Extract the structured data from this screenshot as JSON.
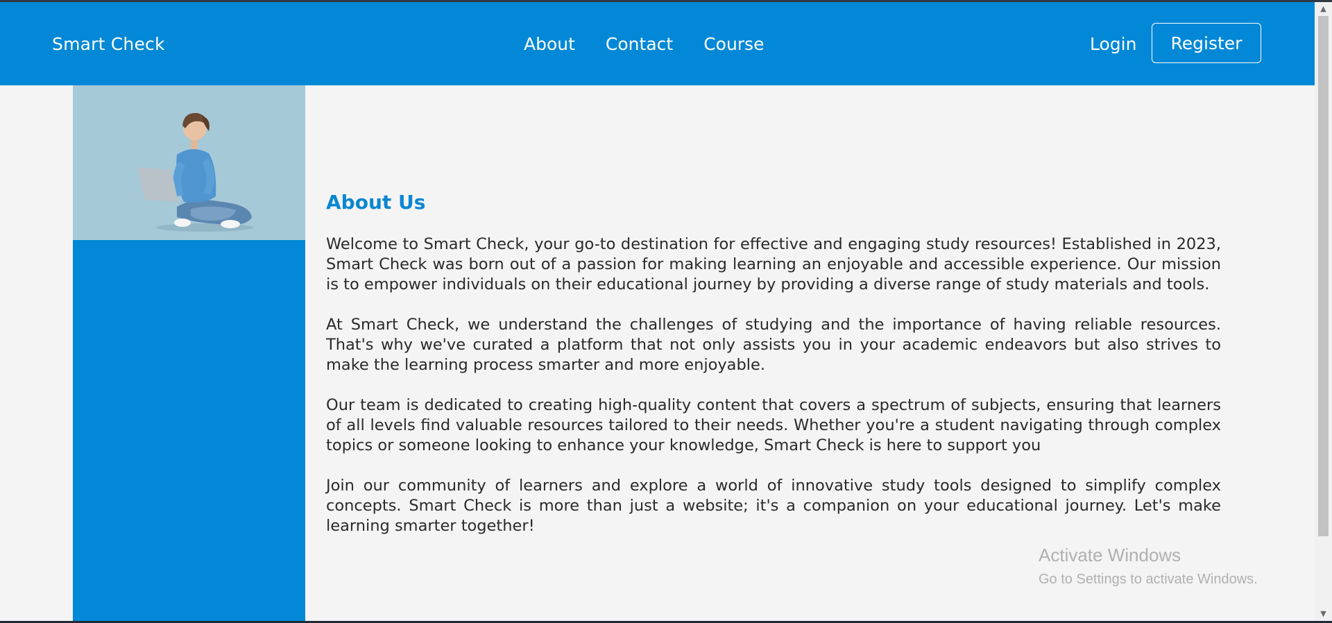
{
  "nav": {
    "brand": "Smart Check",
    "links": [
      "About",
      "Contact",
      "Course"
    ],
    "login": "Login",
    "register": "Register"
  },
  "about": {
    "heading": "About Us",
    "paragraphs": [
      "Welcome to Smart Check, your go-to destination for effective and engaging study resources! Established in 2023, Smart Check was born out of a passion for making learning an enjoyable and accessible experience. Our mission is to empower individuals on their educational journey by providing a diverse range of study materials and tools.",
      "At Smart Check, we understand the challenges of studying and the importance of having reliable resources. That's why we've curated a platform that not only assists you in your academic endeavors but also strives to make the learning process smarter and more enjoyable.",
      "Our team is dedicated to creating high-quality content that covers a spectrum of subjects, ensuring that learners of all levels find valuable resources tailored to their needs. Whether you're a student navigating through complex topics or someone looking to enhance your knowledge, Smart Check is here to support you",
      "Join our community of learners and explore a world of innovative study tools designed to simplify complex concepts. Smart Check is more than just a website; it's a companion on your educational journey. Let's make learning smarter together!"
    ]
  },
  "watermark": {
    "line1": "Activate Windows",
    "line2": "Go to Settings to activate Windows."
  },
  "colors": {
    "brand_blue": "#0288d6",
    "heading_blue": "#0a86d2",
    "page_bg": "#f4f4f4"
  }
}
